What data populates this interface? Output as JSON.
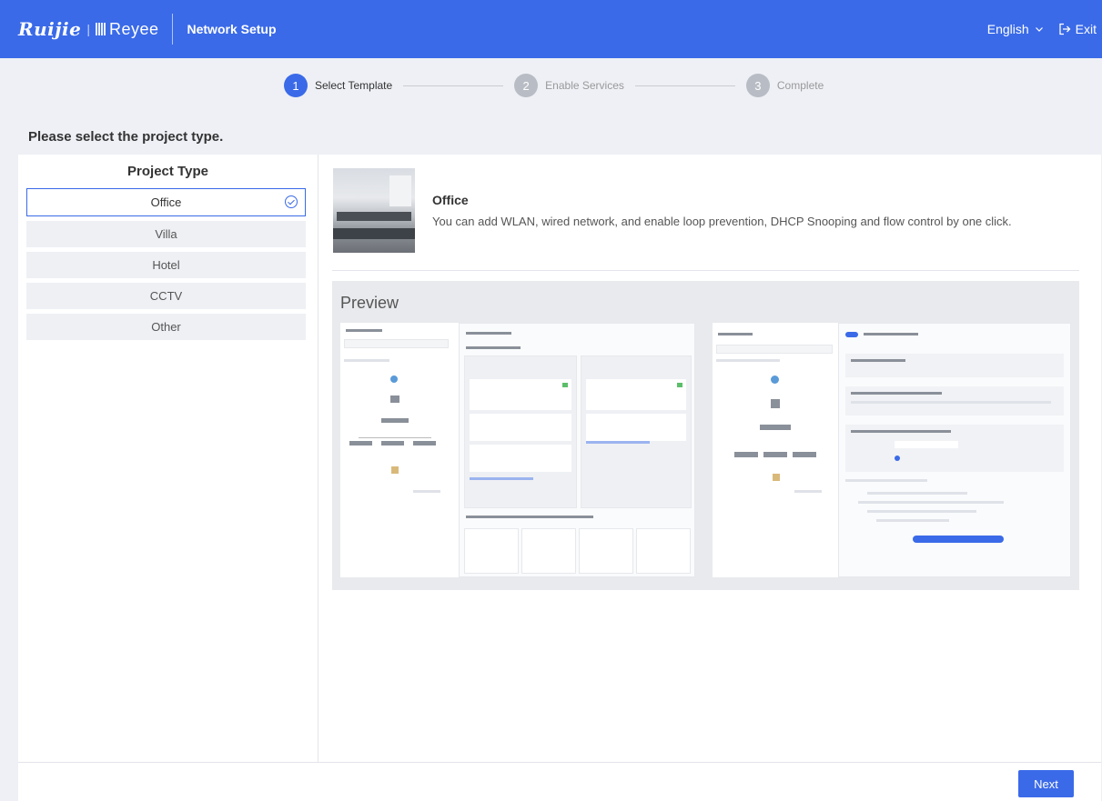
{
  "header": {
    "logo_ruijie": "Ruijie",
    "logo_sep": "|",
    "logo_reyee": "Reyee",
    "title": "Network Setup",
    "language": "English",
    "exit_label": "Exit"
  },
  "steps": [
    {
      "number": "1",
      "label": "Select Template",
      "state": "active"
    },
    {
      "number": "2",
      "label": "Enable Services",
      "state": "inactive"
    },
    {
      "number": "3",
      "label": "Complete",
      "state": "inactive"
    }
  ],
  "page_heading": "Please select the project type.",
  "project_type": {
    "title": "Project Type",
    "items": [
      "Office",
      "Villa",
      "Hotel",
      "CCTV",
      "Other"
    ],
    "selected": "Office"
  },
  "detail": {
    "title": "Office",
    "description": "You can add WLAN, wired network, and enable loop prevention, DHCP Snooping and flow control by one click."
  },
  "preview": {
    "title": "Preview"
  },
  "footer": {
    "next_label": "Next"
  },
  "colors": {
    "primary": "#3a6ae8",
    "page_bg": "#eef0f5",
    "inactive_step": "#b8bcc4"
  }
}
